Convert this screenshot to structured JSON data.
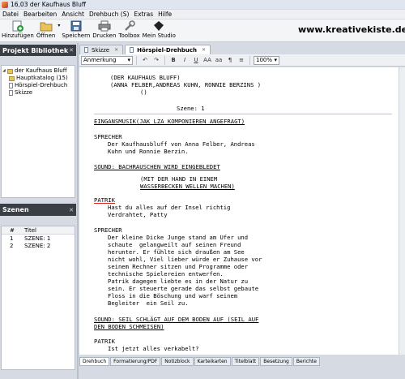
{
  "window": {
    "title": "16,03 der Kaufhaus Bluff"
  },
  "menu": [
    "Datei",
    "Bearbeiten",
    "Ansicht",
    "Drehbuch (S)",
    "Extras",
    "Hilfe"
  ],
  "toolbar": [
    {
      "label": "Hinzufügen",
      "icon": "add-icon"
    },
    {
      "label": "Öffnen",
      "icon": "folder-icon"
    },
    {
      "label": "Speichern",
      "icon": "save-icon"
    },
    {
      "label": "Drucken",
      "icon": "printer-icon"
    },
    {
      "label": "Toolbox",
      "icon": "wrench-icon"
    },
    {
      "label": "Mein Studio",
      "icon": "studio-icon"
    }
  ],
  "website": "www.kreativekiste.de",
  "project": {
    "header": "Projekt Bibliothek",
    "close": "✕",
    "root": "der Kaufhaus Bluff",
    "items": [
      "Hauptkatalog (15)",
      "Hörspiel-Drehbuch",
      "Skizze"
    ]
  },
  "scenes": {
    "header": "Szenen",
    "close": "✕",
    "columns": [
      "#",
      "Titel"
    ],
    "rows": [
      {
        "num": "1",
        "title": "SZENE: 1"
      },
      {
        "num": "2",
        "title": "SZENE: 2"
      }
    ]
  },
  "tabs": [
    {
      "label": "Skizze",
      "close": "✕"
    },
    {
      "label": "Hörspiel-Drehbuch",
      "close": "✕"
    }
  ],
  "format": {
    "style": "Anmerkung",
    "buttons": [
      "↶",
      "↷",
      "B",
      "I",
      "U",
      "AA",
      "aa",
      "¶",
      "≡"
    ],
    "zoom": "100%"
  },
  "script": {
    "title1": "(DER KAUFHAUS BLUFF)",
    "title2": "(ANNA FELBER,ANDREAS KUHN, RONNIE BERZINS )",
    "title3": "()",
    "scene": "Szene: 1",
    "sound1": "EINGANSMUSIK(JAK LZA KOMPONIEREN ANGEFRAGT)",
    "sp1": "SPRECHER",
    "sp1_l1": "Der Kaufhausbluff von Anna Felber, Andreas",
    "sp1_l2": "Kuhn und Ronnie Berzin.",
    "sound2": "SOUND: BACHRAUSCHEN WIRD EINGEBLEDET",
    "dir1": "(MIT DER HAND IN EINEM",
    "dir2": "WASSERBECKEN WELLEN MACHEN)",
    "ch1": "PATRIK",
    "ch1_l1": "Hast du alles auf der Insel richtig",
    "ch1_l2": "Verdrahtet, Patty",
    "sp2": "SPRECHER",
    "sp2_lines": [
      "Der kleine Dicke Junge stand am Ufer und",
      "schaute  gelangweilt auf seinen Freund",
      "herunter. Er fühlte sich draußen am See",
      "nicht wohl, Viel lieber würde er Zuhause vor",
      "seinem Rechner sitzen und Programme oder",
      "technische Spielereien entwerfen.",
      "Patrik dagegen liebte es in der Natur zu",
      "sein. Er steuerte gerade das selbst gebaute",
      "Floss in die Böschung und warf seinem",
      "Begleiter  ein Seil zu."
    ],
    "sound3_l1": "SOUND: SEIL SCHLÄGT AUF DEM BODEN AUF (SEIL AUF",
    "sound3_l2": "DEN BODEN SCHMEISEN)",
    "ch2": "PATRIK",
    "ch2_l1": "Ist jetzt alles verkabelt?"
  },
  "bottom_tabs": [
    "Drehbuch",
    "Formatierung/PDF",
    "Notizblock",
    "Karteikarten",
    "Titelblatt",
    "Besetzung",
    "Berichte"
  ]
}
